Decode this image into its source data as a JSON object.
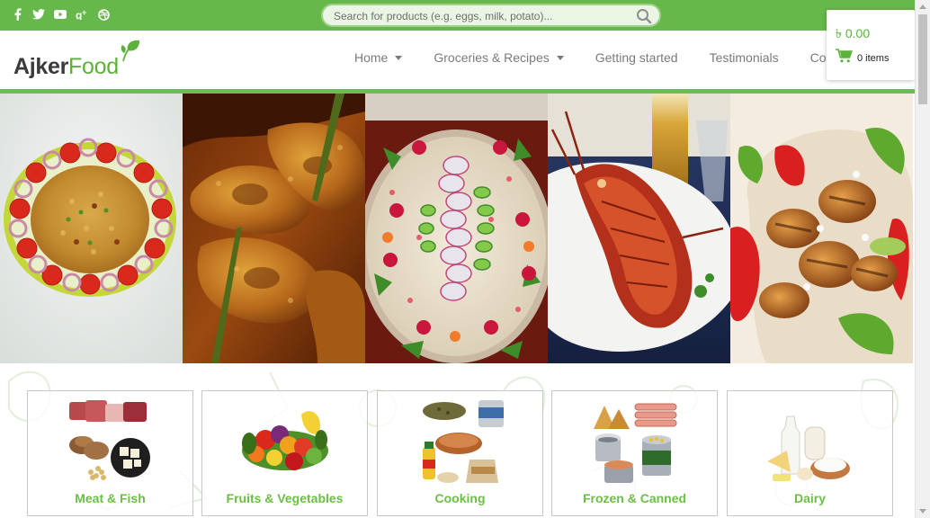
{
  "topbar": {
    "social": [
      {
        "icon": "facebook-icon",
        "glyph": "f"
      },
      {
        "icon": "twitter-icon",
        "glyph": "t"
      },
      {
        "icon": "youtube-icon",
        "glyph": "▶"
      },
      {
        "icon": "google-plus-icon",
        "glyph": "g+"
      },
      {
        "icon": "dribbble-icon",
        "glyph": "◍"
      }
    ],
    "search": {
      "placeholder": "Search for products (e.g. eggs, milk, potato)...",
      "value": ""
    }
  },
  "header": {
    "logo": {
      "part1": "Ajker",
      "part2": "Food"
    },
    "nav": [
      {
        "label": "Home",
        "has_dropdown": true
      },
      {
        "label": "Groceries & Recipes",
        "has_dropdown": true
      },
      {
        "label": "Getting started",
        "has_dropdown": false
      },
      {
        "label": "Testimonials",
        "has_dropdown": false
      },
      {
        "label": "Contact",
        "has_dropdown": false
      }
    ]
  },
  "cart": {
    "total": "৳ 0.00",
    "items": "0 items"
  },
  "hero": {
    "panels": [
      "biryani-photo",
      "fish-curry-photo",
      "pulao-photo",
      "lobster-photo",
      "grilled-chicken-photo"
    ]
  },
  "categories": [
    {
      "label": "Meat & Fish"
    },
    {
      "label": "Fruits & Vegetables"
    },
    {
      "label": "Cooking"
    },
    {
      "label": "Frozen & Canned"
    },
    {
      "label": "Dairy"
    }
  ],
  "colors": {
    "brand_green": "#66b84a",
    "accent_green": "#6cbf46",
    "nav_text": "#7a7a7a"
  }
}
